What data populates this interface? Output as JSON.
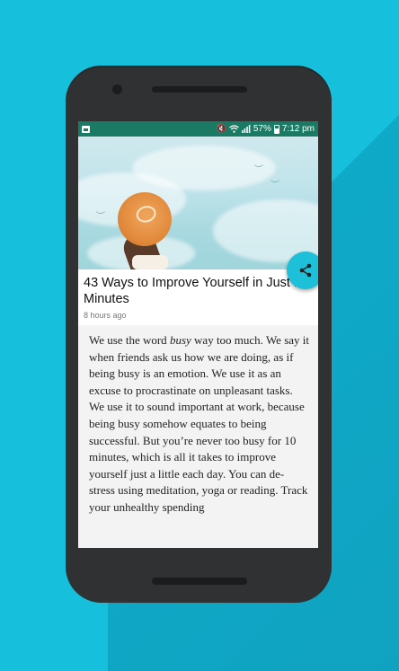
{
  "status_bar": {
    "battery": "57%",
    "time": "7:12 pm"
  },
  "article": {
    "title": "43 Ways to Improve Yourself in Just 10 Minutes",
    "time_ago": "8 hours ago",
    "body_start": "We use the word ",
    "body_em": "busy",
    "body_rest": " way too much. We say it when friends ask us how we are doing, as if being busy is an emotion. We use it as an excuse to procrastinate on unpleasant tasks. We use it to sound important at work, because being busy somehow equates to being successful. But you’re never too busy for 10 minutes, which is all it takes to improve yourself just a little each day. You can de-stress using meditation, yoga or reading. Track your unhealthy spending"
  },
  "colors": {
    "background": "#16c0dc",
    "status_bar": "#1b7a63",
    "fab": "#1dbfd9",
    "phone_body": "#2f3133"
  },
  "icons": {
    "share": "share-icon",
    "gallery": "image-icon",
    "mute": "mute-icon",
    "wifi": "wifi-icon",
    "signal": "signal-icon",
    "battery": "battery-icon"
  }
}
